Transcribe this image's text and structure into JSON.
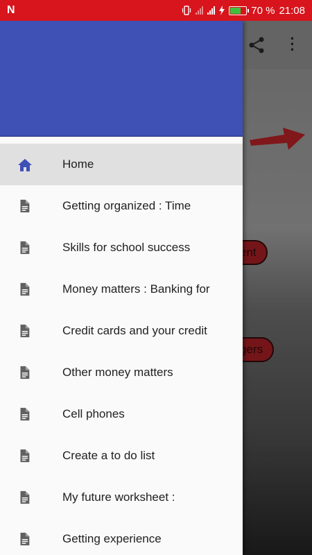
{
  "status_bar": {
    "carrier_icon": "N",
    "battery_percent": "70 %",
    "battery_level": 0.7,
    "time": "21:08",
    "bar_color": "#d8141c"
  },
  "background": {
    "pill_1": "ent",
    "pill_2": "gers",
    "icons": [
      "share-icon",
      "more-vert-icon"
    ]
  },
  "drawer": {
    "header_color": "#3f51b5",
    "items": [
      {
        "label": "Home",
        "icon": "home-icon",
        "active": true
      },
      {
        "label": "Getting organized : Time",
        "icon": "document-icon"
      },
      {
        "label": "Skills for school success",
        "icon": "document-icon"
      },
      {
        "label": "Money matters : Banking for",
        "icon": "document-icon"
      },
      {
        "label": "Credit cards and your credit",
        "icon": "document-icon"
      },
      {
        "label": "Other money matters",
        "icon": "document-icon"
      },
      {
        "label": "Cell phones",
        "icon": "document-icon"
      },
      {
        "label": "Create a to do list",
        "icon": "document-icon"
      },
      {
        "label": "My future worksheet :",
        "icon": "document-icon"
      },
      {
        "label": "Getting experience",
        "icon": "document-icon"
      }
    ]
  }
}
